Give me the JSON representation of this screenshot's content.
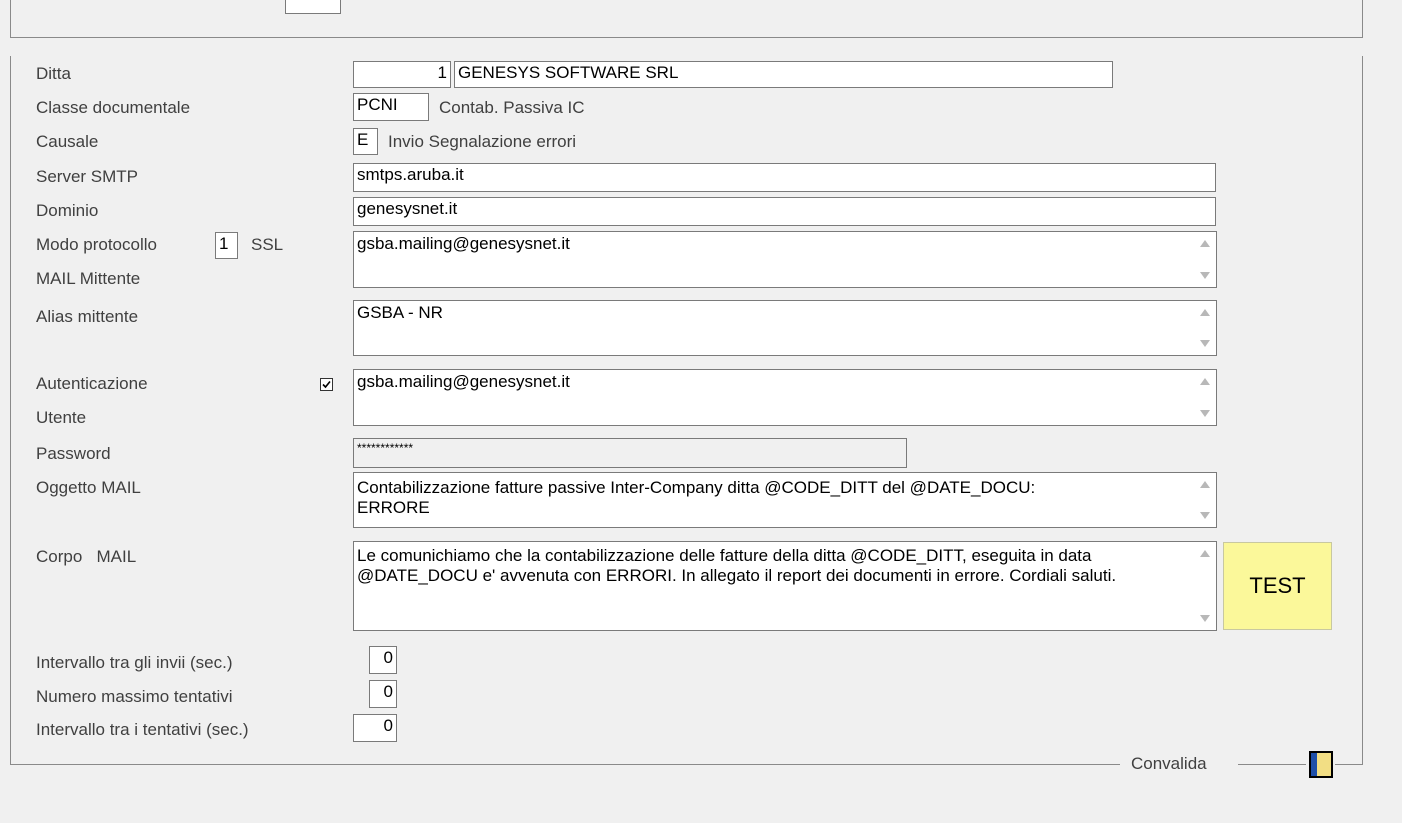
{
  "form": {
    "ditta": {
      "label": "Ditta",
      "code": "1",
      "name": "GENESYS SOFTWARE SRL"
    },
    "classe_documentale": {
      "label": "Classe documentale",
      "code": "PCNI",
      "desc": "Contab. Passiva IC"
    },
    "causale": {
      "label": "Causale",
      "code": "E",
      "desc": "Invio Segnalazione errori"
    },
    "server_smtp": {
      "label": "Server SMTP",
      "value": "smtps.aruba.it"
    },
    "dominio": {
      "label": "Dominio",
      "value": "genesysnet.it"
    },
    "modo_protocollo": {
      "label": "Modo protocollo",
      "code": "1",
      "desc": "SSL"
    },
    "mail_mittente": {
      "label": "MAIL Mittente",
      "value": "gsba.mailing@genesysnet.it"
    },
    "alias_mittente": {
      "label": "Alias mittente",
      "value": "GSBA - NR"
    },
    "autenticazione": {
      "label": "Autenticazione",
      "checked": true
    },
    "utente": {
      "label": "Utente",
      "value": "gsba.mailing@genesysnet.it"
    },
    "password": {
      "label": "Password",
      "value": "************"
    },
    "oggetto_mail": {
      "label": "Oggetto MAIL",
      "value": "Contabilizzazione fatture passive Inter-Company ditta @CODE_DITT del @DATE_DOCU: ERRORE"
    },
    "corpo_mail": {
      "label": "Corpo   MAIL",
      "value": "Le comunichiamo che la contabilizzazione delle fatture della ditta @CODE_DITT, eseguita in data @DATE_DOCU e' avvenuta con ERRORI. In allegato il report dei documenti in errore. Cordiali saluti."
    },
    "intervallo_invii": {
      "label": "Intervallo tra gli invii (sec.)",
      "value": "0"
    },
    "numero_tentativi": {
      "label": "Numero massimo tentativi",
      "value": "0"
    },
    "intervallo_tentativi": {
      "label": "Intervallo tra i tentativi (sec.)",
      "value": "0"
    }
  },
  "buttons": {
    "test_label": "TEST"
  },
  "footer": {
    "convalida_label": "Convalida"
  },
  "colors": {
    "test_bg": "#fbf89a",
    "window_bg": "#f0f0f0"
  }
}
